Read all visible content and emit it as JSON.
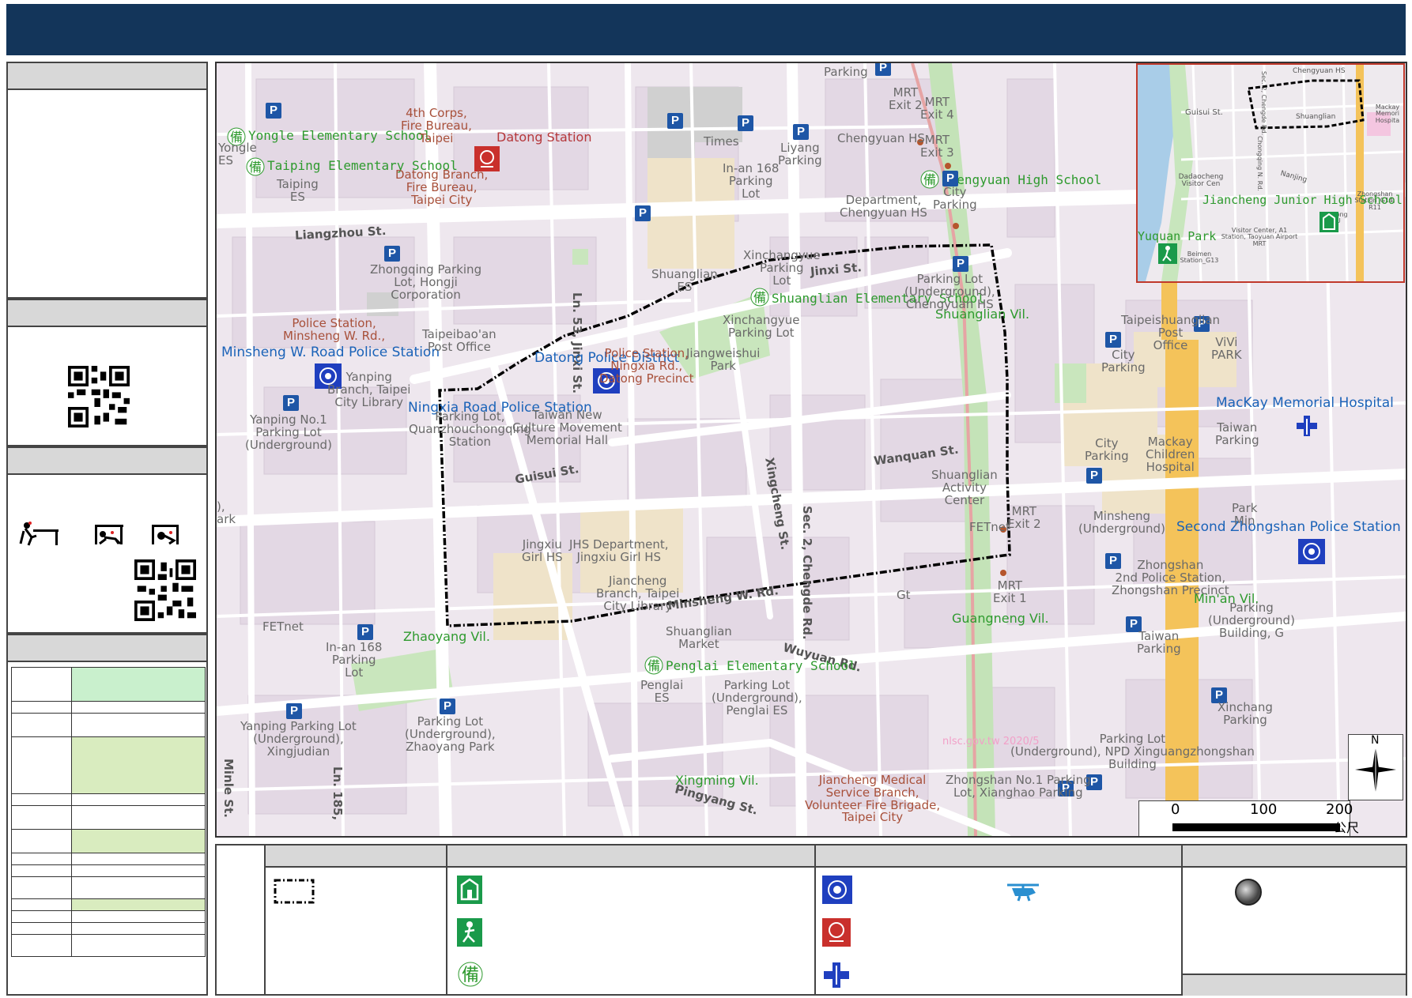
{
  "map": {
    "streets": [
      "Liangzhou St.",
      "Ln. 53, Jinxi St.",
      "Jinxi St.",
      "Guisui St.",
      "Wanquan St.",
      "Xingcheng St.",
      "Sec. 2, Chengde Rd.",
      "Minsheng W. Rd.",
      "Pingyang St.",
      "Ln. 185,",
      "Minle St.",
      "Wuyuan Rd."
    ],
    "schools": [
      "Yongle Elementary School",
      "Taiping Elementary School",
      "Shuanglian Elementary School",
      "Chengyuan High School",
      "Penglai Elementary School"
    ],
    "villages": [
      "Shuanglian Vil.",
      "Zhaoyang Vil.",
      "Guangneng Vil.",
      "Min'an Vil.",
      "Xingming Vil."
    ],
    "police": [
      "Minsheng W. Road Police Station",
      "Datong Police District",
      "Ningxia Road Police Station",
      "Second Zhongshan Police Station"
    ],
    "fire": "Datong Station",
    "hospital": "MacKay Memorial Hospital",
    "labels": {
      "fire_corps": "4th Corps,\nFire Bureau,\nTaipei",
      "fire_branch": "Datong Branch,\nFire Bureau,\nTaipei City",
      "yongle_es": "Yongle\nES",
      "taiping_es": "Taiping\nES",
      "parking_top": "Parking",
      "inan168": "In-an 168\nParking\nLot",
      "times": "Times",
      "liyang": "Liyang\nParking",
      "chengyuan_hs": "Chengyuan HS",
      "chengyuan_dept": "Department,\nChengyuan HS",
      "mrt_exit2": "MRT\nExit 2",
      "mrt_exit4": "MRT\nExit 4",
      "mrt_exit3": "MRT\nExit 3",
      "city_parking1": "City\nParking",
      "zhongqing": "Zhongqing Parking\nLot, Hongji\nCorporation",
      "shuanglian": "Shuanglian\nES",
      "xinchangyue": "Xinchangyue\nParking\nLot",
      "parking_underground": "Parking Lot\n(Underground),\nChengyuan HS",
      "police_minsheng": "Police Station,\nMinsheng W. Rd.,",
      "taipeibaoan": "Taipeibao'an\nPost Office",
      "police_ningxia": "Police Station,\nNingxia Rd.,\nDatong Precinct",
      "xinchangyue2": "Xinchangyue\nParking Lot",
      "jiangweishui": "Jiangweishui\nPark",
      "yanping_lib": "Yanping\nBranch, Taipei\nCity Library",
      "yanping_no1": "Yanping No.1\nParking Lot\n(Underground)",
      "quanzhou": "Parking Lot,\nQuanzhouchongqing\nStation",
      "culture_hall": "Taiwan New\nCulture Movement\nMemorial Hall",
      "tp_shuanglian_po": "Taipeishuanglian\nPost\nOffice",
      "city_parking2": "City\nParking",
      "vivi": "ViVi\nPARK",
      "mackay_children": "Mackay\nChildren\nHospital",
      "taiwan_parking1": "Taiwan\nParking",
      "city_parking3": "City\nParking",
      "jingxiu": "Jingxiu\nGirl HS",
      "jhs_dept": "JHS Department,\nJingxiu Girl HS",
      "shuanglian_act": "Shuanglian\nActivity\nCenter",
      "mrt_exit2b": "MRT\nExit 2",
      "fetnet1": "FETnet",
      "minsheng_ug": "Minsheng\n(Underground)",
      "zhongshan_2nd": "Zhongshan\n2nd Police Station,\nZhongshan Precinct",
      "jiancheng_lib": "Jiancheng\nBranch, Taipei\nCity Library",
      "fetnet2": "FETnet",
      "mrt_exit1": "MRT\nExit 1",
      "gt": "Gt",
      "inan168b": "In-an 168\nParking\nLot",
      "shuanglian_mkt": "Shuanglian\nMarket",
      "taiwan_parking2": "Taiwan\nParking",
      "parking_bldg": "Parking\n(Underground)\nBuilding, G",
      "penglai_es": "Penglai\nES",
      "penglai_parking": "Parking Lot\n(Underground),\nPenglai ES",
      "yanping_ug": "Yanping Parking Lot\n(Underground),\nXingjudian",
      "zhaoyang_park": "Parking Lot\n(Underground),\nZhaoyang Park",
      "xinchang": "Xinchang\nParking",
      "npd": "Parking Lot\n(Underground), NPD Xinguangzhongshan\nBuilding",
      "jiancheng_med": "Jiancheng Medical\nService Branch,\nVolunteer Fire Brigade,\nTaipei City",
      "zhongshan_no1": "Zhongshan No.1 Parking\nLot, Xianghao Parking",
      "watermark": "nlsc.gov.tw 2020/5",
      "ark": "),\nark",
      "park_min": "Park\nMin"
    }
  },
  "inset": {
    "school": "Jiancheng Junior High School",
    "park": "Yuquan Park",
    "labels": [
      "Chengyuan HS",
      "Guisui St.",
      "Shuanglian",
      "Mackay Memori Hospita",
      "Dadaocheng Visitor Cen",
      "Nanjing",
      "Zhongshan Station_G14, R11",
      "Datong CU",
      "Visitor Center, A1 Station, Taoyuan Airport MRT",
      "Beimen Station_G13",
      "Sec. 2, Chengde Rd.",
      "Chongqing N. Rd."
    ]
  },
  "scale": {
    "ticks": [
      "0",
      "100",
      "200"
    ],
    "unit": "公尺"
  },
  "north": "N",
  "legend": {
    "dei_symbol": "備"
  }
}
